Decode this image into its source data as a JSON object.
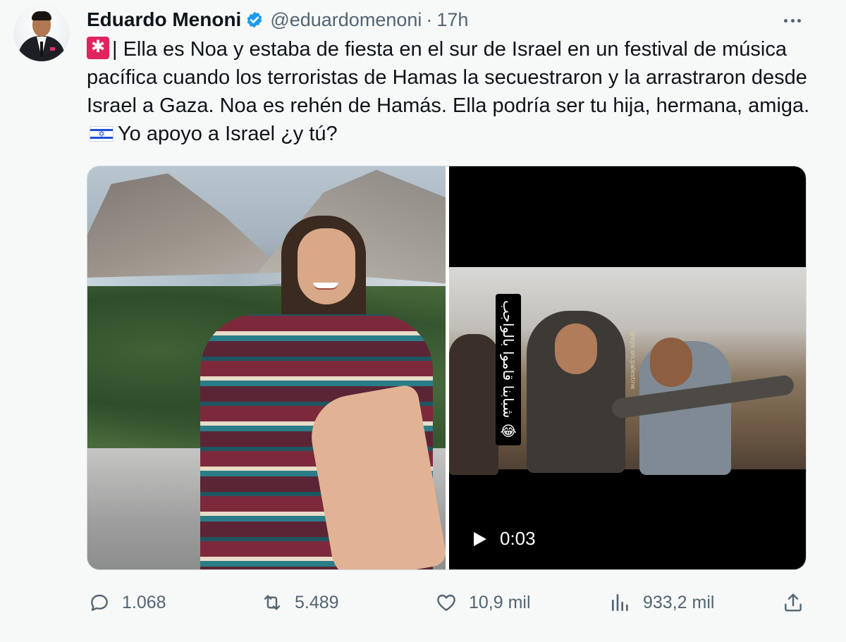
{
  "author": {
    "name": "Eduardo Menoni",
    "handle": "@eduardomenoni",
    "separator": "·",
    "time": "17h"
  },
  "tweet": {
    "line_prefix": "| Ella es Noa y estaba de fiesta en el sur de Israel en un festival de música pacífica cuando los terroristas de Hamas la secuestraron y la arrastraron desde Israel a Gaza. Noa es rehén de Hamás.  Ella podría ser tu hija, hermana, amiga.",
    "line_suffix": "Yo apoyo a Israel ¿y tú?",
    "flag_star": "✡"
  },
  "video": {
    "overlay_text": "شبابنا قاموا بالواجب 😂",
    "watermark": "@eye.on.palestine",
    "duration": "0:03"
  },
  "actions": {
    "replies": "1.068",
    "retweets": "5.489",
    "likes": "10,9 mil",
    "views": "933,2 mil"
  },
  "colors": {
    "text": "#0f1419",
    "secondary": "#536471",
    "verified": "#1d9bf0",
    "background": "#f7f9f9"
  },
  "icons": [
    "siren-emoji-icon",
    "israel-flag-icon",
    "verified-badge-icon",
    "more-options-icon",
    "reply-icon",
    "retweet-icon",
    "like-icon",
    "views-icon",
    "share-icon",
    "play-icon"
  ]
}
